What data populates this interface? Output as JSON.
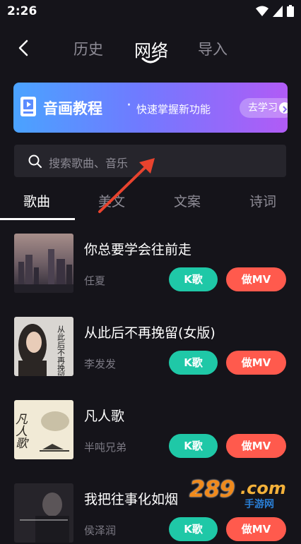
{
  "status": {
    "time": "2:26"
  },
  "nav": {
    "tabs": [
      "历史",
      "网络",
      "导入"
    ],
    "active": 1
  },
  "banner": {
    "title": "音画教程",
    "dot": "·",
    "subtitle": "快速掌握新功能",
    "button": "去学习"
  },
  "search": {
    "placeholder": "搜索歌曲、音乐"
  },
  "categories": [
    "歌曲",
    "美文",
    "文案",
    "诗词"
  ],
  "songs": [
    {
      "title": "你总要学会往前走",
      "artist": "任夏",
      "k_label": "K歌",
      "mv_label": "做MV"
    },
    {
      "title": "从此后不再挽留(女版)",
      "artist": "李发发",
      "k_label": "K歌",
      "mv_label": "做MV",
      "cover_text": "从此后不再挽留"
    },
    {
      "title": "凡人歌",
      "artist": "半吨兄弟",
      "k_label": "K歌",
      "mv_label": "做MV",
      "cover_text": "凡人歌"
    },
    {
      "title": "我把往事化如烟",
      "artist": "侯泽润",
      "k_label": "K歌",
      "mv_label": "做MV"
    }
  ],
  "watermark": {
    "number": "289",
    "domain": ".com",
    "cn": "手游网"
  },
  "colors": {
    "background": "#15141a",
    "k_button": "#1fc8a7",
    "mv_button": "#ff5a4d",
    "arrow": "#e8432e"
  }
}
